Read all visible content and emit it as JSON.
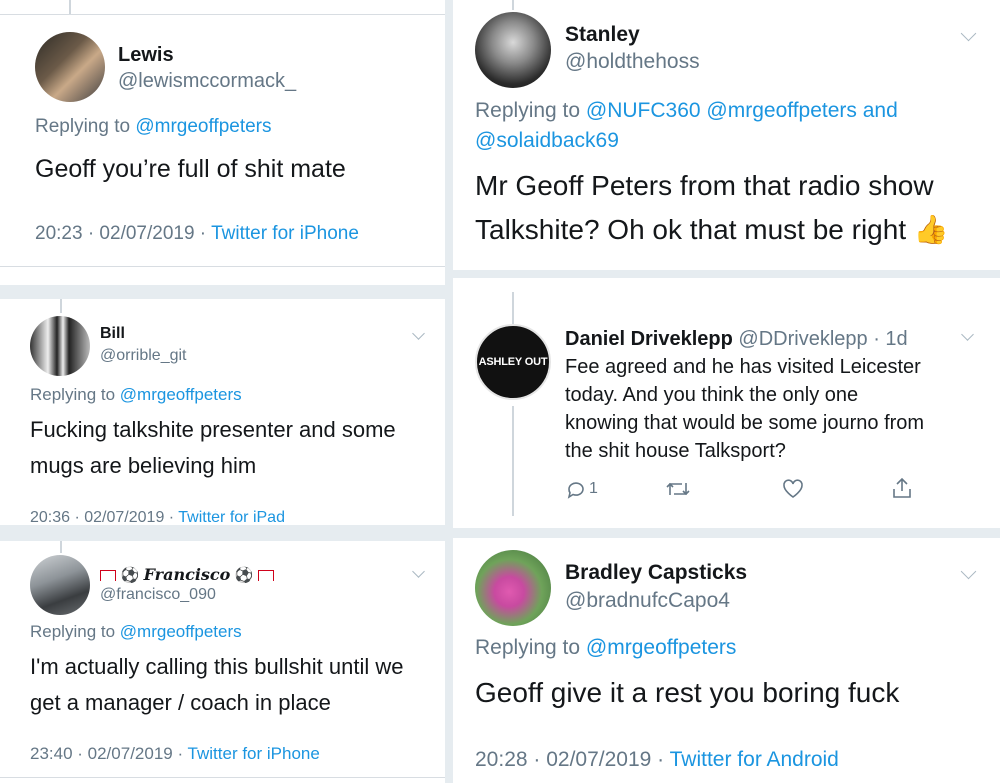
{
  "tweets": {
    "lewis": {
      "name": "Lewis",
      "handle": "@lewismccormack_",
      "replying_prefix": "Replying to",
      "replying_to": "@mrgeoffpeters",
      "text": "Geoff you’re full of shit mate",
      "time": "20:23 · 02/07/2019 ·",
      "source": "Twitter for iPhone"
    },
    "stanley": {
      "name": "Stanley",
      "handle": "@holdthehoss",
      "replying_prefix": "Replying to",
      "replying_line1": "@NUFC360 @mrgeoffpeters and",
      "replying_line2": "@solaidback69",
      "text_line1": "Mr Geoff Peters from that radio show",
      "text_line2": "Talkshite? Oh ok that must be right",
      "emoji": "👍"
    },
    "bill": {
      "name": "Bill",
      "handle": "@orrible_git",
      "replying_prefix": "Replying to",
      "replying_to": "@mrgeoffpeters",
      "text_line1": "Fucking talkshite presenter and some",
      "text_line2": "mugs are believing him",
      "time": "20:36 · 02/07/2019 ·",
      "source": "Twitter for iPad"
    },
    "daniel": {
      "name": "Daniel Driveklepp",
      "handle": "@DDriveklepp",
      "age": "· 1d",
      "avatar_text": "ASHLEY OUT",
      "text_line1": "Fee agreed and he has visited Leicester",
      "text_line2": "today. And you think the only one",
      "text_line3": "knowing that would be some journo from",
      "text_line4": "the shit house Talksport?",
      "reply_count": "1"
    },
    "francisco": {
      "name": "Francisco",
      "handle": "@francisco_090",
      "replying_prefix": "Replying to",
      "replying_to": "@mrgeoffpeters",
      "text_line1": "I'm actually calling this bullshit until we",
      "text_line2": "get a manager / coach in place",
      "time": "23:40 · 02/07/2019 ·",
      "source": "Twitter for iPhone"
    },
    "bradley": {
      "name": "Bradley Capsticks",
      "handle": "@bradnufcCapo4",
      "replying_prefix": "Replying to",
      "replying_to": "@mrgeoffpeters",
      "text": "Geoff give it a rest you boring fuck",
      "time": "20:28 · 02/07/2019 ·",
      "source": "Twitter for Android"
    }
  }
}
